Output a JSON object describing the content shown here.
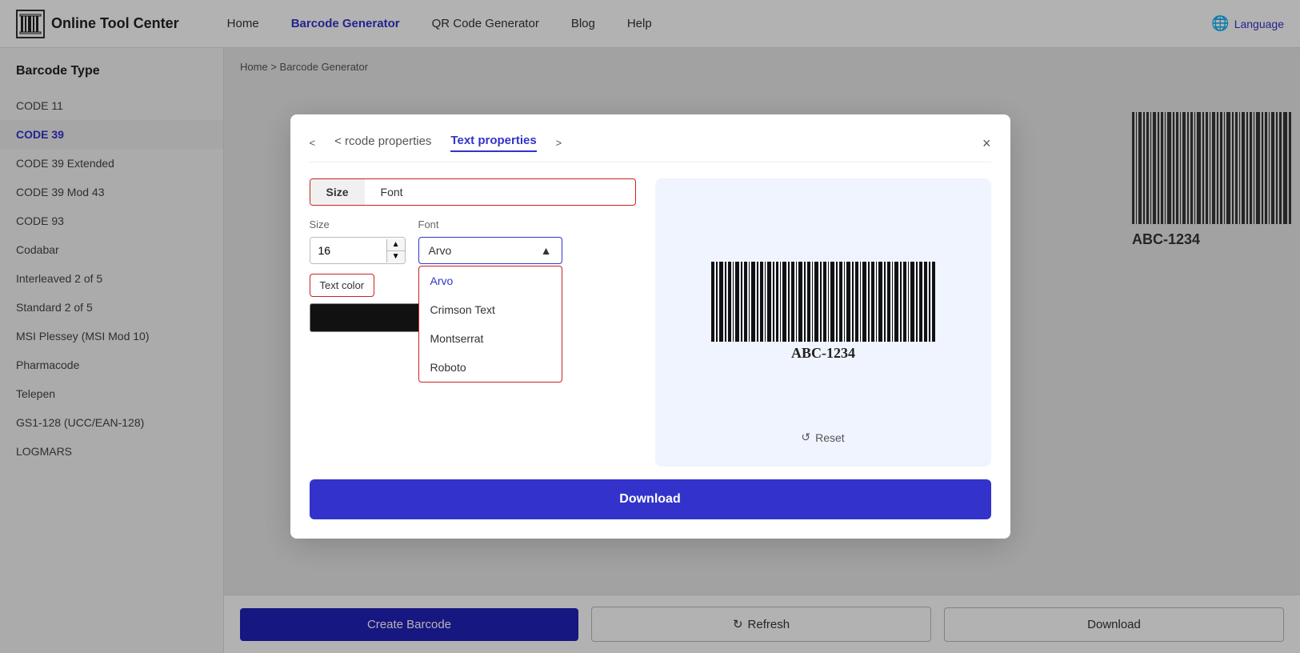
{
  "header": {
    "logo_text": "Online Tool Center",
    "nav_items": [
      {
        "label": "Home",
        "active": false
      },
      {
        "label": "Barcode Generator",
        "active": true
      },
      {
        "label": "QR Code Generator",
        "active": false
      },
      {
        "label": "Blog",
        "active": false
      },
      {
        "label": "Help",
        "active": false
      }
    ],
    "language_label": "Language"
  },
  "sidebar": {
    "title": "Barcode Type",
    "items": [
      {
        "label": "CODE 11",
        "active": false
      },
      {
        "label": "CODE 39",
        "active": true
      },
      {
        "label": "CODE 39 Extended",
        "active": false
      },
      {
        "label": "CODE 39 Mod 43",
        "active": false
      },
      {
        "label": "CODE 93",
        "active": false
      },
      {
        "label": "Codabar",
        "active": false
      },
      {
        "label": "Interleaved 2 of 5",
        "active": false
      },
      {
        "label": "Standard 2 of 5",
        "active": false
      },
      {
        "label": "MSI Plessey (MSI Mod 10)",
        "active": false
      },
      {
        "label": "Pharmacode",
        "active": false
      },
      {
        "label": "Telepen",
        "active": false
      },
      {
        "label": "GS1-128 (UCC/EAN-128)",
        "active": false
      },
      {
        "label": "LOGMARS",
        "active": false
      }
    ]
  },
  "breadcrumb": {
    "home": "Home",
    "separator": ">",
    "current": "Barcode Generator"
  },
  "bottom_bar": {
    "create_label": "Create Barcode",
    "refresh_label": "Refresh",
    "download_label": "Download"
  },
  "modal": {
    "tab_prev_label": "< rcode properties",
    "tab_active_label": "Text properties",
    "tab_next_arrow": ">",
    "close_label": "×",
    "prop_tabs": [
      {
        "label": "Size",
        "active": true
      },
      {
        "label": "Font",
        "active": false
      }
    ],
    "size_label": "Size",
    "font_label": "Font",
    "size_value": "16",
    "font_selected": "Arvo",
    "font_options": [
      {
        "label": "Arvo",
        "active": true
      },
      {
        "label": "Crimson Text",
        "active": false
      },
      {
        "label": "Montserrat",
        "active": false
      },
      {
        "label": "Roboto",
        "active": false
      }
    ],
    "text_color_label": "Text color",
    "barcode_text": "ABC-1234",
    "reset_label": "Reset",
    "download_label": "Download"
  }
}
